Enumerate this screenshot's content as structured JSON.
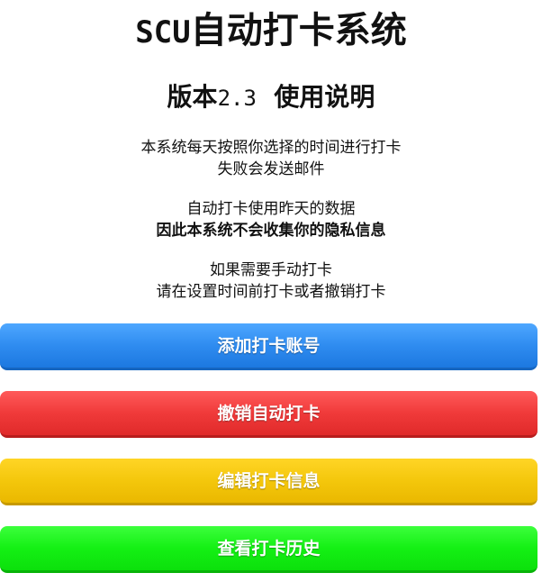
{
  "header": {
    "title_latin": "SCU",
    "title_cjk": "自动打卡系统",
    "subtitle_prefix": "版本",
    "version": "2.3",
    "subtitle_suffix": "使用说明"
  },
  "instructions": {
    "para1": [
      "本系统每天按照你选择的时间进行打卡",
      "失败会发送邮件"
    ],
    "para2": [
      "自动打卡使用昨天的数据",
      "因此本系统不会收集你的隐私信息"
    ],
    "para3": [
      "如果需要手动打卡",
      "请在设置时间前打卡或者撤销打卡"
    ]
  },
  "buttons": {
    "add_account": "添加打卡账号",
    "cancel_auto": "撤销自动打卡",
    "edit_info": "编辑打卡信息",
    "view_history": "查看打卡历史"
  },
  "colors": {
    "blue": "#2f8cf0",
    "red": "#f03a3a",
    "yellow": "#f4c70c",
    "green": "#14f014"
  }
}
